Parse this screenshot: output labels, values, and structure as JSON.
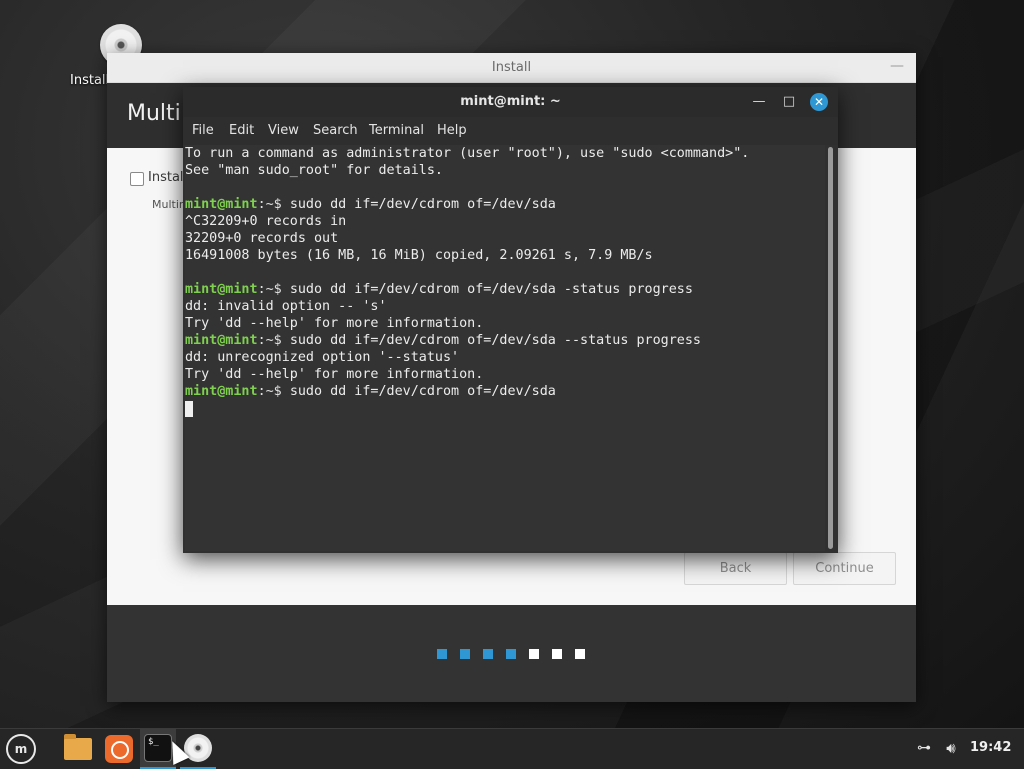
{
  "desktop": {
    "install_icon_label": "Install"
  },
  "installer": {
    "window_title": "Install",
    "heading": "Multi",
    "option_label": "Install",
    "option_sublabel": "Multin",
    "back_label": "Back",
    "continue_label": "Continue",
    "progress": {
      "total_steps": 7,
      "completed_steps": 4,
      "active_color": "#2f98d4",
      "inactive_color": "#ffffff"
    }
  },
  "terminal": {
    "title": "mint@mint: ~",
    "menu": [
      "File",
      "Edit",
      "View",
      "Search",
      "Terminal",
      "Help"
    ],
    "lines": [
      {
        "text": "To run a command as administrator (user \"root\"), use \"sudo <command>\"."
      },
      {
        "text": "See \"man sudo_root\" for details."
      },
      {
        "text": ""
      },
      {
        "prompt_user": "mint@mint",
        "prompt_path": ":~$ ",
        "text": "sudo dd if=/dev/cdrom of=/dev/sda"
      },
      {
        "text": "^C32209+0 records in"
      },
      {
        "text": "32209+0 records out"
      },
      {
        "text": "16491008 bytes (16 MB, 16 MiB) copied, 2.09261 s, 7.9 MB/s"
      },
      {
        "text": ""
      },
      {
        "prompt_user": "mint@mint",
        "prompt_path": ":~$ ",
        "text": "sudo dd if=/dev/cdrom of=/dev/sda -status progress"
      },
      {
        "text": "dd: invalid option -- 's'"
      },
      {
        "text": "Try 'dd --help' for more information."
      },
      {
        "prompt_user": "mint@mint",
        "prompt_path": ":~$ ",
        "text": "sudo dd if=/dev/cdrom of=/dev/sda --status progress"
      },
      {
        "text": "dd: unrecognized option '--status'"
      },
      {
        "text": "Try 'dd --help' for more information."
      },
      {
        "prompt_user": "mint@mint",
        "prompt_path": ":~$ ",
        "text": "sudo dd if=/dev/cdrom of=/dev/sda"
      }
    ]
  },
  "taskbar": {
    "terminal_icon_text": "$_",
    "clock": "19:42",
    "icons": {
      "menu": "mint-logo-icon",
      "files": "folder-icon",
      "firefox": "firefox-icon",
      "terminal": "terminal-icon",
      "disc": "disc-icon",
      "network": "network-icon",
      "volume": "volume-icon"
    }
  }
}
